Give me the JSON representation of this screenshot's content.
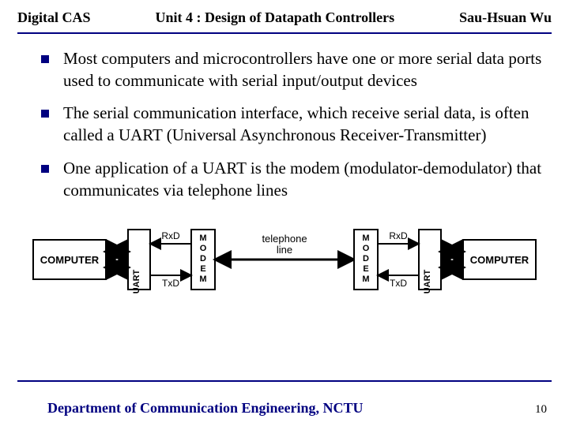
{
  "header": {
    "left": "Digital CAS",
    "center": "Unit 4 : Design of Datapath Controllers",
    "right": "Sau-Hsuan Wu"
  },
  "bullets": [
    "Most computers and microcontrollers have one or more serial data ports used to communicate with serial input/output devices",
    "The serial communication interface, which receive serial data, is often called a UART (Universal Asynchronous Receiver-Transmitter)",
    "One application of a UART is the modem (modulator-demodulator) that communicates via telephone lines"
  ],
  "diagram": {
    "left": {
      "computer": "COMPUTER",
      "uart": "UART",
      "modem": "MODEM",
      "rxd": "RxD",
      "txd": "TxD"
    },
    "center": "telephone line",
    "right": {
      "computer": "COMPUTER",
      "uart": "UART",
      "modem": "MODEM",
      "rxd": "RxD",
      "txd": "TxD"
    }
  },
  "footer": {
    "dept": "Department of Communication Engineering, NCTU",
    "page": "10"
  }
}
